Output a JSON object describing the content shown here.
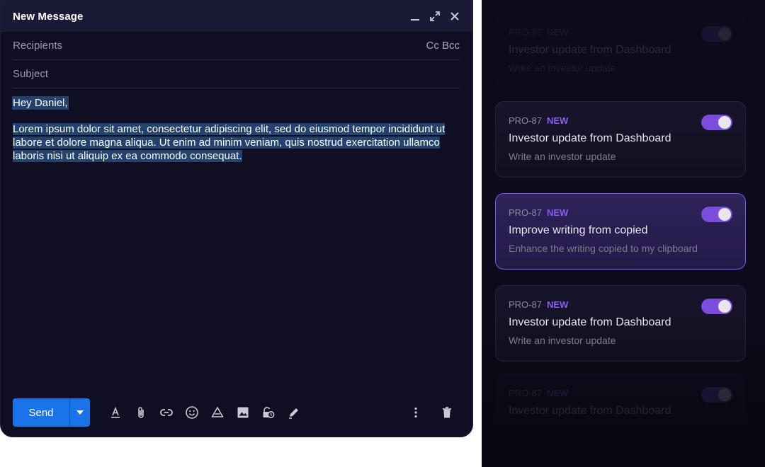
{
  "compose": {
    "title": "New Message",
    "recipients_placeholder": "Recipients",
    "cc_bcc": "Cc Bcc",
    "subject_placeholder": "Subject",
    "greeting": "Hey Daniel,",
    "body": "Lorem ipsum dolor sit amet, consectetur adipiscing elit, sed do eiusmod tempor incididunt ut labore et dolore magna aliqua. Ut enim ad minim veniam, quis nostrud exercitation ullamco laboris nisi ut aliquip ex ea commodo consequat.",
    "send_label": "Send",
    "icons": [
      "format-text-icon",
      "attach-icon",
      "link-icon",
      "emoji-icon",
      "drive-icon",
      "image-icon",
      "confidential-icon",
      "signature-icon",
      "more-icon",
      "trash-icon"
    ]
  },
  "colors": {
    "send": "#1a73e8",
    "accent": "#8b5cf6",
    "toggle_on": "#7c4ddb",
    "selection": "#23426d"
  },
  "cards": [
    {
      "id": "PRO-87",
      "badge": "NEW",
      "title": "Investor update from Dashboard",
      "desc": "Write an investor update",
      "enabled": true
    },
    {
      "id": "PRO-87",
      "badge": "NEW",
      "title": "Investor update from Dashboard",
      "desc": "Write an investor update",
      "enabled": true
    },
    {
      "id": "PRO-87",
      "badge": "NEW",
      "title": "Improve writing from copied",
      "desc": "Enhance the writing copied to my clipboard",
      "enabled": true
    },
    {
      "id": "PRO-87",
      "badge": "NEW",
      "title": "Investor update from Dashboard",
      "desc": "Write an investor update",
      "enabled": true
    },
    {
      "id": "PRO-87",
      "badge": "NEW",
      "title": "Investor update from Dashboard",
      "desc": "",
      "enabled": true
    }
  ]
}
